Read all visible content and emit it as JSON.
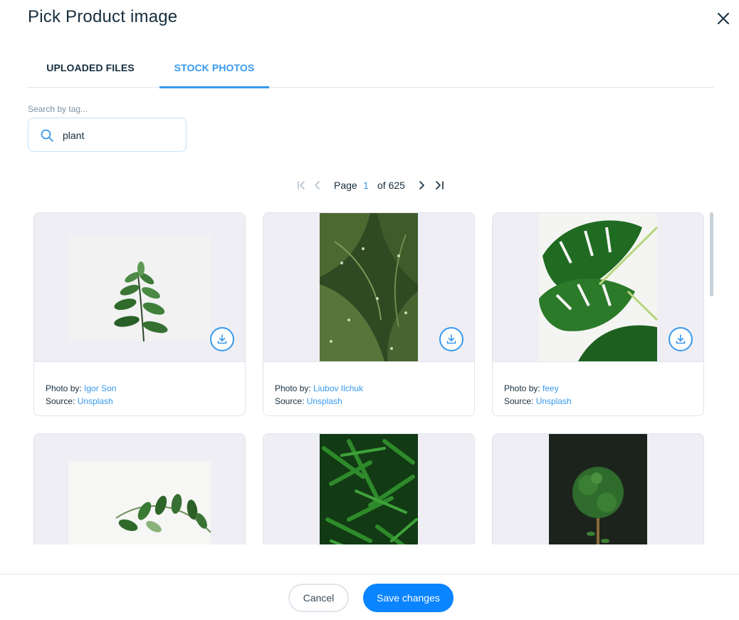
{
  "dialog": {
    "title": "Pick Product image",
    "close_icon": "close-icon"
  },
  "tabs": [
    {
      "label": "UPLOADED FILES",
      "active": false
    },
    {
      "label": "STOCK PHOTOS",
      "active": true
    }
  ],
  "search": {
    "label": "Search by tag...",
    "value": "plant",
    "icon": "search-icon"
  },
  "pagination": {
    "page_label": "Page",
    "current_page": "1",
    "of_label": "of 625"
  },
  "photo_credit_prefix": "Photo by:",
  "source_prefix": "Source:",
  "photos": [
    {
      "author": "Igor Son",
      "source": "Unsplash"
    },
    {
      "author": "Liubov Ilchuk",
      "source": "Unsplash"
    },
    {
      "author": "feey",
      "source": "Unsplash"
    },
    {
      "author": "",
      "source": ""
    },
    {
      "author": "",
      "source": ""
    },
    {
      "author": "",
      "source": ""
    }
  ],
  "footer": {
    "cancel_label": "Cancel",
    "save_label": "Save changes"
  },
  "colors": {
    "accent": "#3899ec",
    "primary_button": "#0a84ff",
    "title_text": "#162d3d",
    "thumb_background": "#eeeef4"
  }
}
